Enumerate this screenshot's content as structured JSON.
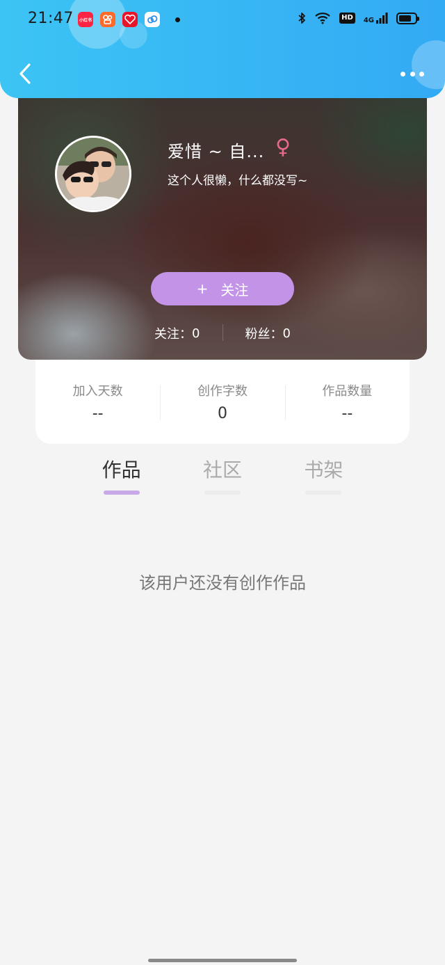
{
  "status_bar": {
    "time": "21:47",
    "app_icons": [
      "xiaohongshu-icon",
      "kuaishou-icon",
      "baihe-icon",
      "cloud-app-icon"
    ],
    "xiaohongshu_label": "小红书",
    "network": "4G",
    "hd": "HD",
    "battery_level": 0.75
  },
  "header": {
    "back_icon": "chevron-left-icon",
    "more_icon": "more-horizontal-icon"
  },
  "profile": {
    "nickname": "爱惜 ~  自...",
    "gender_symbol": "♀",
    "bio": "这个人很懒，什么都没写~",
    "follow_button": {
      "plus": "+",
      "label": "关注"
    },
    "following": {
      "label": "关注：",
      "value": "0"
    },
    "followers": {
      "label": "粉丝：",
      "value": "0"
    }
  },
  "stats": [
    {
      "label": "加入天数",
      "value": "--"
    },
    {
      "label": "创作字数",
      "value": "0"
    },
    {
      "label": "作品数量",
      "value": "--"
    }
  ],
  "tabs": [
    {
      "label": "作品",
      "active": true
    },
    {
      "label": "社区",
      "active": false
    },
    {
      "label": "书架",
      "active": false
    }
  ],
  "empty_message": "该用户还没有创作作品",
  "colors": {
    "header_gradient_start": "#3cc4f4",
    "header_gradient_end": "#33aaf4",
    "follow_button": "#c293e6",
    "active_tab_underline": "#c9a8e8",
    "gender_female": "#e86a8a"
  }
}
